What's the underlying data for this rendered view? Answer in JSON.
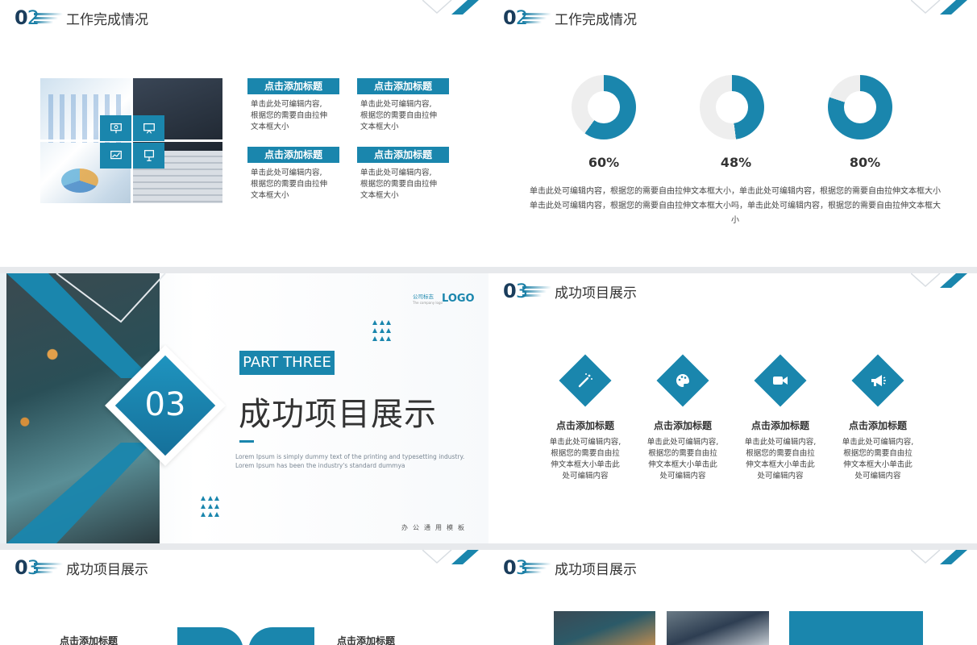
{
  "slide1": {
    "num_a": "0",
    "num_b": "2",
    "title": "工作完成情况",
    "cards": [
      {
        "title": "点击添加标题",
        "body": [
          "单击此处可编辑内容,",
          "根据您的需要自由拉伸",
          "文本框大小"
        ]
      },
      {
        "title": "点击添加标题",
        "body": [
          "单击此处可编辑内容,",
          "根据您的需要自由拉伸",
          "文本框大小"
        ]
      },
      {
        "title": "点击添加标题",
        "body": [
          "单击此处可编辑内容,",
          "根据您的需要自由拉伸",
          "文本框大小"
        ]
      },
      {
        "title": "点击添加标题",
        "body": [
          "单击此处可编辑内容,",
          "根据您的需要自由拉伸",
          "文本框大小"
        ]
      }
    ]
  },
  "slide2": {
    "num_a": "0",
    "num_b": "2",
    "title": "工作完成情况",
    "donuts": [
      {
        "label": "60%",
        "value": 60
      },
      {
        "label": "48%",
        "value": 48
      },
      {
        "label": "80%",
        "value": 80
      }
    ],
    "paragraph": [
      "单击此处可编辑内容，根据您的需要自由拉伸文本框大小，单击此处可编辑内容，根据您的需要自由拉伸文本框大小",
      "单击此处可编辑内容，根据您的需要自由拉伸文本框大小吗，单击此处可编辑内容，根据您的需要自由拉伸文本框大",
      "小"
    ]
  },
  "slide3": {
    "number": "03",
    "part": "PART THREE",
    "title": "成功项目展示",
    "lorem": [
      "Lorem Ipsum is simply dummy text of the printing and typesetting industry.",
      "Lorem Ipsum has been the industry's standard dummya"
    ],
    "logo_small": "公司标志",
    "logo_small_sub": "The company logo",
    "logo": "LOGO",
    "footer": "办公通用模板"
  },
  "slide4": {
    "num_a": "0",
    "num_b": "3",
    "title": "成功项目展示",
    "items": [
      {
        "icon": "magic-wand-icon",
        "title": "点击添加标题",
        "body": [
          "单击此处可编辑内容,",
          "根据您的需要自由拉",
          "伸文本框大小单击此",
          "处可编辑内容"
        ]
      },
      {
        "icon": "palette-icon",
        "title": "点击添加标题",
        "body": [
          "单击此处可编辑内容,",
          "根据您的需要自由拉",
          "伸文本框大小单击此",
          "处可编辑内容"
        ]
      },
      {
        "icon": "video-camera-icon",
        "title": "点击添加标题",
        "body": [
          "单击此处可编辑内容,",
          "根据您的需要自由拉",
          "伸文本框大小单击此",
          "处可编辑内容"
        ]
      },
      {
        "icon": "megaphone-icon",
        "title": "点击添加标题",
        "body": [
          "单击此处可编辑内容,",
          "根据您的需要自由拉",
          "伸文本框大小单击此",
          "处可编辑内容"
        ]
      }
    ]
  },
  "slide5": {
    "num_a": "0",
    "num_b": "3",
    "title": "成功项目展示",
    "left_title": "点击添加标题",
    "right_title": "点击添加标题"
  },
  "slide6": {
    "num_a": "0",
    "num_b": "3",
    "title": "成功项目展示"
  },
  "colors": {
    "accent": "#1a86ad",
    "dark": "#1a3d5c",
    "track": "#eeeeee"
  }
}
